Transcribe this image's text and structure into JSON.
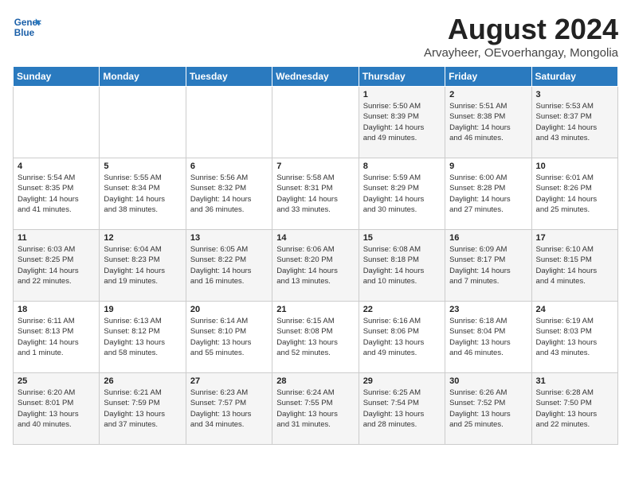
{
  "header": {
    "logo_line1": "General",
    "logo_line2": "Blue",
    "month": "August 2024",
    "location": "Arvayheer, OEvoerhangay, Mongolia"
  },
  "weekdays": [
    "Sunday",
    "Monday",
    "Tuesday",
    "Wednesday",
    "Thursday",
    "Friday",
    "Saturday"
  ],
  "weeks": [
    [
      {
        "day": "",
        "info": ""
      },
      {
        "day": "",
        "info": ""
      },
      {
        "day": "",
        "info": ""
      },
      {
        "day": "",
        "info": ""
      },
      {
        "day": "1",
        "info": "Sunrise: 5:50 AM\nSunset: 8:39 PM\nDaylight: 14 hours\nand 49 minutes."
      },
      {
        "day": "2",
        "info": "Sunrise: 5:51 AM\nSunset: 8:38 PM\nDaylight: 14 hours\nand 46 minutes."
      },
      {
        "day": "3",
        "info": "Sunrise: 5:53 AM\nSunset: 8:37 PM\nDaylight: 14 hours\nand 43 minutes."
      }
    ],
    [
      {
        "day": "4",
        "info": "Sunrise: 5:54 AM\nSunset: 8:35 PM\nDaylight: 14 hours\nand 41 minutes."
      },
      {
        "day": "5",
        "info": "Sunrise: 5:55 AM\nSunset: 8:34 PM\nDaylight: 14 hours\nand 38 minutes."
      },
      {
        "day": "6",
        "info": "Sunrise: 5:56 AM\nSunset: 8:32 PM\nDaylight: 14 hours\nand 36 minutes."
      },
      {
        "day": "7",
        "info": "Sunrise: 5:58 AM\nSunset: 8:31 PM\nDaylight: 14 hours\nand 33 minutes."
      },
      {
        "day": "8",
        "info": "Sunrise: 5:59 AM\nSunset: 8:29 PM\nDaylight: 14 hours\nand 30 minutes."
      },
      {
        "day": "9",
        "info": "Sunrise: 6:00 AM\nSunset: 8:28 PM\nDaylight: 14 hours\nand 27 minutes."
      },
      {
        "day": "10",
        "info": "Sunrise: 6:01 AM\nSunset: 8:26 PM\nDaylight: 14 hours\nand 25 minutes."
      }
    ],
    [
      {
        "day": "11",
        "info": "Sunrise: 6:03 AM\nSunset: 8:25 PM\nDaylight: 14 hours\nand 22 minutes."
      },
      {
        "day": "12",
        "info": "Sunrise: 6:04 AM\nSunset: 8:23 PM\nDaylight: 14 hours\nand 19 minutes."
      },
      {
        "day": "13",
        "info": "Sunrise: 6:05 AM\nSunset: 8:22 PM\nDaylight: 14 hours\nand 16 minutes."
      },
      {
        "day": "14",
        "info": "Sunrise: 6:06 AM\nSunset: 8:20 PM\nDaylight: 14 hours\nand 13 minutes."
      },
      {
        "day": "15",
        "info": "Sunrise: 6:08 AM\nSunset: 8:18 PM\nDaylight: 14 hours\nand 10 minutes."
      },
      {
        "day": "16",
        "info": "Sunrise: 6:09 AM\nSunset: 8:17 PM\nDaylight: 14 hours\nand 7 minutes."
      },
      {
        "day": "17",
        "info": "Sunrise: 6:10 AM\nSunset: 8:15 PM\nDaylight: 14 hours\nand 4 minutes."
      }
    ],
    [
      {
        "day": "18",
        "info": "Sunrise: 6:11 AM\nSunset: 8:13 PM\nDaylight: 14 hours\nand 1 minute."
      },
      {
        "day": "19",
        "info": "Sunrise: 6:13 AM\nSunset: 8:12 PM\nDaylight: 13 hours\nand 58 minutes."
      },
      {
        "day": "20",
        "info": "Sunrise: 6:14 AM\nSunset: 8:10 PM\nDaylight: 13 hours\nand 55 minutes."
      },
      {
        "day": "21",
        "info": "Sunrise: 6:15 AM\nSunset: 8:08 PM\nDaylight: 13 hours\nand 52 minutes."
      },
      {
        "day": "22",
        "info": "Sunrise: 6:16 AM\nSunset: 8:06 PM\nDaylight: 13 hours\nand 49 minutes."
      },
      {
        "day": "23",
        "info": "Sunrise: 6:18 AM\nSunset: 8:04 PM\nDaylight: 13 hours\nand 46 minutes."
      },
      {
        "day": "24",
        "info": "Sunrise: 6:19 AM\nSunset: 8:03 PM\nDaylight: 13 hours\nand 43 minutes."
      }
    ],
    [
      {
        "day": "25",
        "info": "Sunrise: 6:20 AM\nSunset: 8:01 PM\nDaylight: 13 hours\nand 40 minutes."
      },
      {
        "day": "26",
        "info": "Sunrise: 6:21 AM\nSunset: 7:59 PM\nDaylight: 13 hours\nand 37 minutes."
      },
      {
        "day": "27",
        "info": "Sunrise: 6:23 AM\nSunset: 7:57 PM\nDaylight: 13 hours\nand 34 minutes."
      },
      {
        "day": "28",
        "info": "Sunrise: 6:24 AM\nSunset: 7:55 PM\nDaylight: 13 hours\nand 31 minutes."
      },
      {
        "day": "29",
        "info": "Sunrise: 6:25 AM\nSunset: 7:54 PM\nDaylight: 13 hours\nand 28 minutes."
      },
      {
        "day": "30",
        "info": "Sunrise: 6:26 AM\nSunset: 7:52 PM\nDaylight: 13 hours\nand 25 minutes."
      },
      {
        "day": "31",
        "info": "Sunrise: 6:28 AM\nSunset: 7:50 PM\nDaylight: 13 hours\nand 22 minutes."
      }
    ]
  ]
}
